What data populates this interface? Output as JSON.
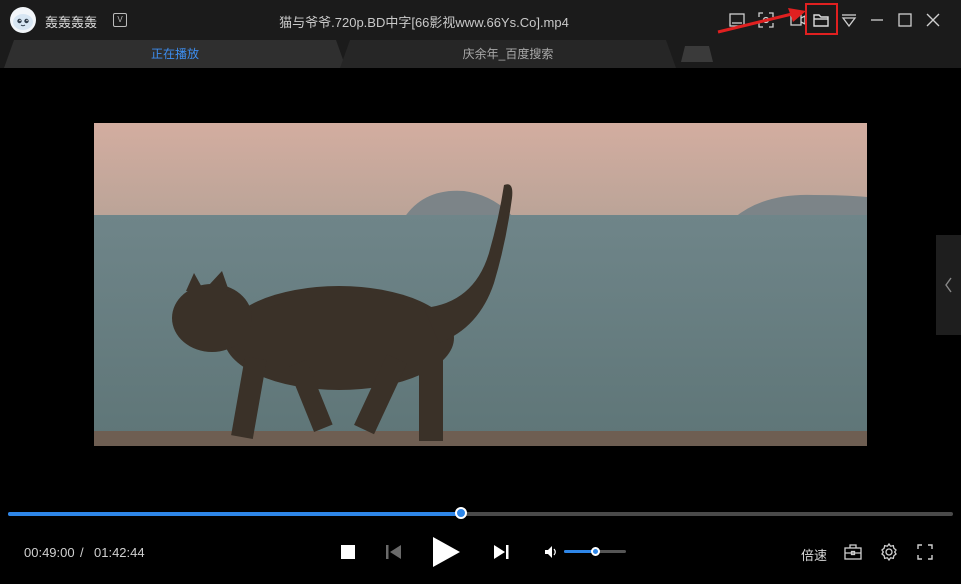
{
  "app": {
    "username": "轰轰轰轰",
    "badge": "V",
    "window_title": "猫与爷爷.720p.BD中字[66影视www.66Ys.Co].mp4"
  },
  "tabs": [
    {
      "label": "正在播放",
      "active": true
    },
    {
      "label": "庆余年_百度搜索",
      "active": false
    }
  ],
  "titlebar_icons": [
    "subtitle-icon",
    "screenshot-icon",
    "open-folder-icon",
    "dropdown-menu-icon",
    "minimize-icon",
    "maximize-icon",
    "close-icon"
  ],
  "annotation": {
    "color": "#e02020",
    "target": "open-folder-icon"
  },
  "playback": {
    "current_time": "00:49:00",
    "separator": "/",
    "total_time": "01:42:44",
    "progress": 0.4795,
    "volume": 0.5,
    "speed_label": "倍速"
  },
  "colors": {
    "accent": "#2e86e8",
    "background": "#000000",
    "titlebar": "#1b1b1b"
  }
}
